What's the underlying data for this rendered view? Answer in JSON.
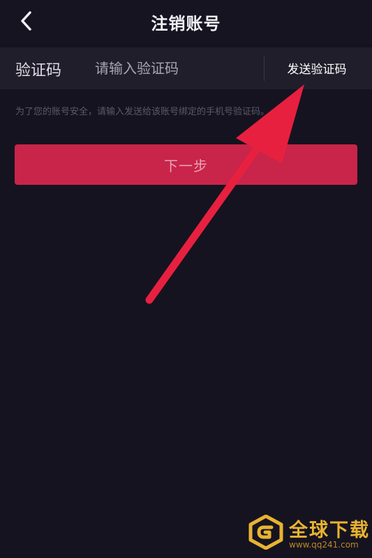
{
  "header": {
    "title": "注销账号",
    "back_icon": "chevron-left-icon"
  },
  "verify": {
    "label": "验证码",
    "placeholder": "请输入验证码",
    "value": "",
    "send_code_label": "发送验证码"
  },
  "hint": {
    "text": "为了您的账号安全，请输入发送给该账号绑定的手机号验证码。"
  },
  "next_button": {
    "label": "下一步"
  },
  "annotation": {
    "icon": "red-arrow-icon",
    "color": "#e8203f"
  },
  "watermark": {
    "logo_icon": "g-logo-icon",
    "brand": "全球下载",
    "url": "www.qq241.com",
    "color": "#e8b330"
  },
  "theme": {
    "background": "#161320",
    "accent": "#c9244a"
  }
}
